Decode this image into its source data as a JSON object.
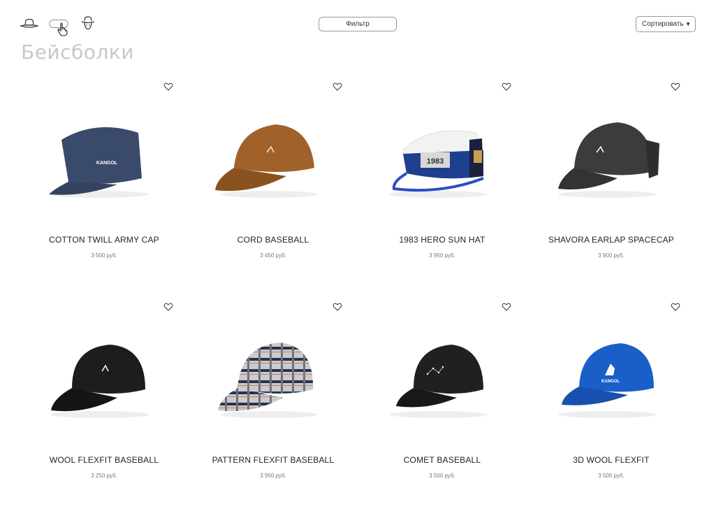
{
  "header": {
    "filter_label": "Фильтр",
    "sort_label": "Сортировать",
    "category_icons": [
      "fedora-hat-icon",
      "cap-icon",
      "man-with-hat-icon"
    ]
  },
  "page_title": "Бейсболки",
  "products": [
    {
      "name": "COTTON TWILL ARMY CAP",
      "price": "3 500 руб.",
      "color": "#3a4a6b"
    },
    {
      "name": "CORD BASEBALL",
      "price": "3 450 руб.",
      "color": "#a0612a"
    },
    {
      "name": "1983 HERO SUN HAT",
      "price": "3 950 руб.",
      "color": "#1e3f8f"
    },
    {
      "name": "SHAVORA EARLAP SPACECAP",
      "price": "3 900 руб.",
      "color": "#3c3c3c"
    },
    {
      "name": "WOOL FLEXFIT BASEBALL",
      "price": "3 250 руб.",
      "color": "#1d1d1d"
    },
    {
      "name": "PATTERN FLEXFIT BASEBALL",
      "price": "3 950 руб.",
      "color": "#8a8d98"
    },
    {
      "name": "COMET BASEBALL",
      "price": "3 500 руб.",
      "color": "#202020"
    },
    {
      "name": "3D WOOL FLEXFIT",
      "price": "3 500 руб.",
      "color": "#1a5fc8"
    }
  ]
}
